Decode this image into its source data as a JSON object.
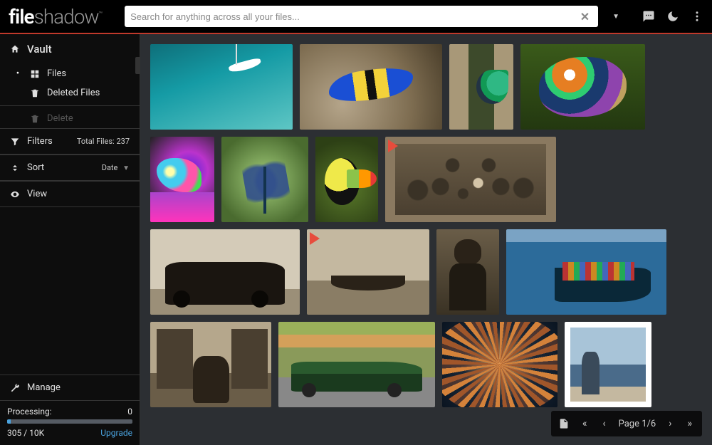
{
  "app": {
    "logo_bold": "file",
    "logo_light": "shadow",
    "tm": "™"
  },
  "search": {
    "placeholder": "Search for anything across all your files..."
  },
  "sidebar": {
    "vault": "Vault",
    "files": "Files",
    "deleted": "Deleted Files",
    "delete": "Delete",
    "filters": "Filters",
    "filters_meta": "Total Files: 237",
    "sort": "Sort",
    "sort_value": "Date",
    "view": "View",
    "manage": "Manage"
  },
  "processing": {
    "label": "Processing:",
    "count": "0",
    "quota": "305 / 10K",
    "upgrade": "Upgrade"
  },
  "pager": {
    "page_label": "Page 1/6"
  }
}
